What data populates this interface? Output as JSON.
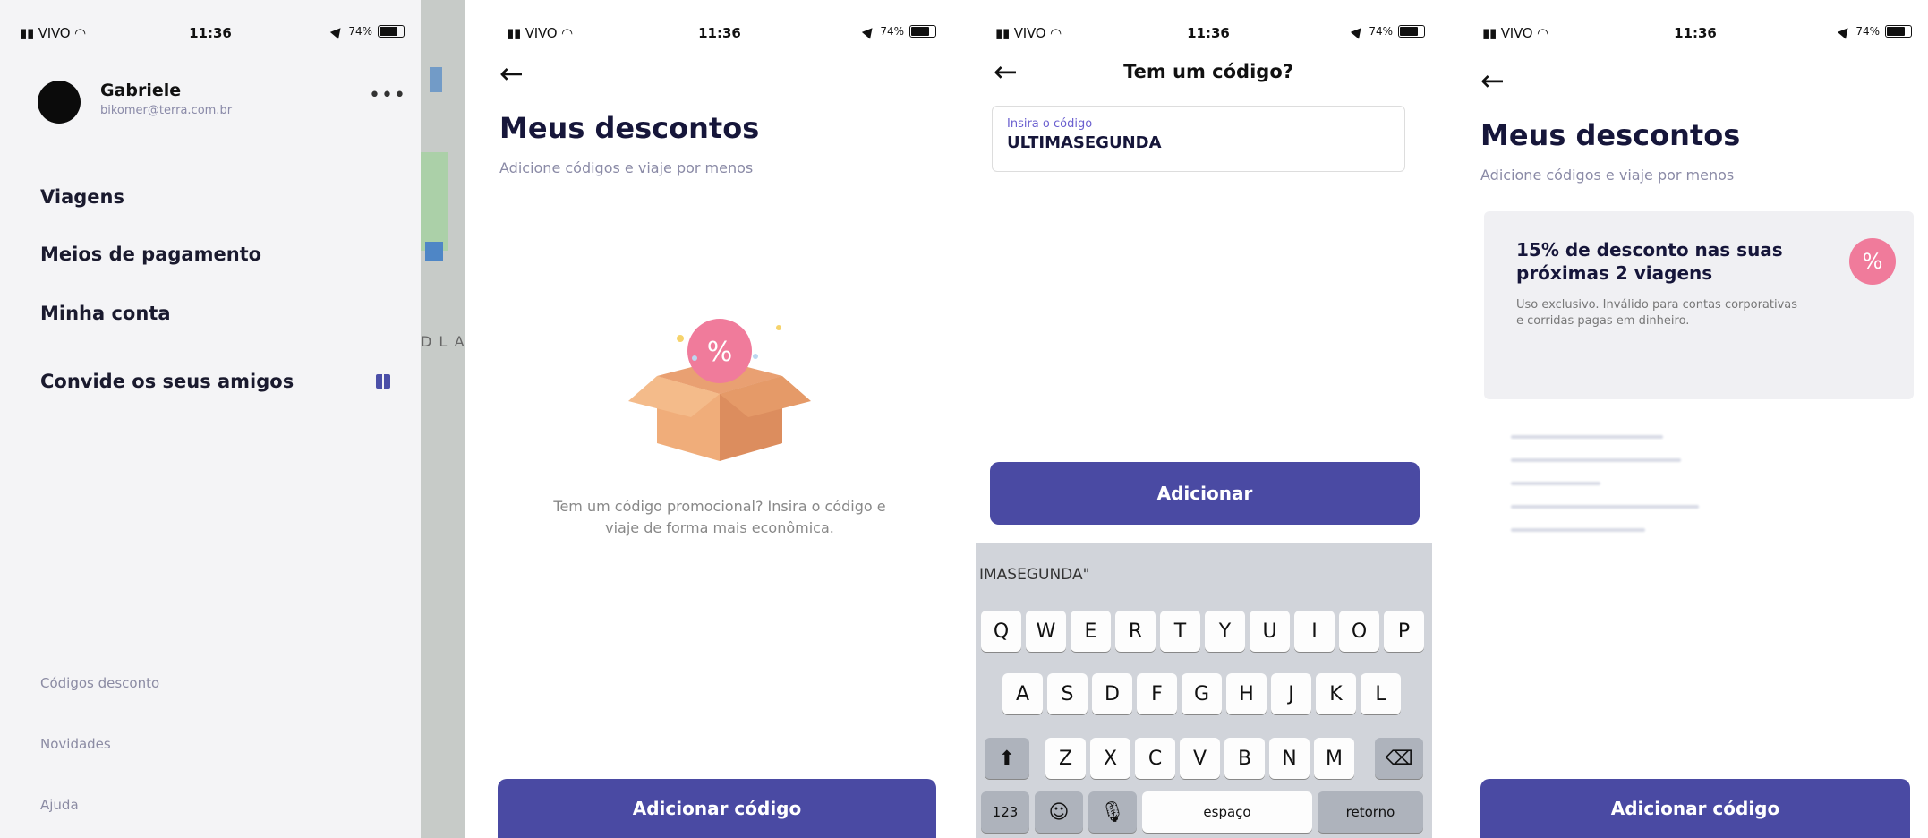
{
  "status_bar": {
    "carrier": "VIVO",
    "time": "11:36",
    "battery": "74%"
  },
  "screen1": {
    "user": {
      "name": "Gabriele",
      "email": "bikomer@terra.com.br"
    },
    "more_label": "•••",
    "menu": [
      "Viagens",
      "Meios de pagamento",
      "Minha conta",
      "Convide os seus amigos"
    ],
    "footer": [
      "Códigos desconto",
      "Novidades",
      "Ajuda"
    ]
  },
  "screen2": {
    "title": "Meus descontos",
    "subtitle": "Adicione códigos e viaje por menos",
    "empty_text": "Tem um código promocional? Insira o código e viaje de forma mais econômica.",
    "button": "Adicionar código"
  },
  "screen3": {
    "title": "Tem um código?",
    "field_label": "Insira o código",
    "field_value": "ULTIMASEGUNDA",
    "button": "Adicionar",
    "suggestion": "IMASEGUNDA\"",
    "keys_row1": [
      "Q",
      "W",
      "E",
      "R",
      "T",
      "Y",
      "U",
      "I",
      "O",
      "P"
    ],
    "keys_row2": [
      "A",
      "S",
      "D",
      "F",
      "G",
      "H",
      "J",
      "K",
      "L"
    ],
    "keys_row3": [
      "Z",
      "X",
      "C",
      "V",
      "B",
      "N",
      "M"
    ],
    "key_numbers": "123",
    "key_space": "espaço",
    "key_return": "retorno"
  },
  "screen4": {
    "title": "Meus descontos",
    "subtitle": "Adicione códigos e viaje por menos",
    "card_title": "15% de desconto nas suas próximas 2 viagens",
    "card_desc": "Uso exclusivo. Inválido para contas corporativas e corridas pagas em dinheiro.",
    "button": "Adicionar código"
  },
  "colors": {
    "primary": "#4a4aa3",
    "pink": "#f07b9b",
    "drawer_bg": "#f4f4f6"
  },
  "icons": {
    "back": "arrow-left-icon",
    "gift": "gift-icon",
    "percent": "percent-icon",
    "shift": "shift-icon",
    "delete": "backspace-icon",
    "emoji": "emoji-icon",
    "mic": "microphone-icon"
  }
}
